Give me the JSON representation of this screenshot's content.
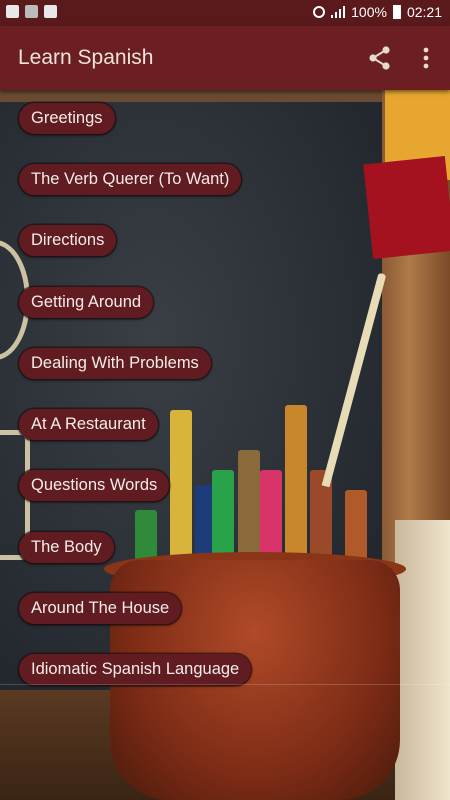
{
  "status_bar": {
    "left_icons": [
      "facebook-icon",
      "m-app-icon",
      "image-icon"
    ],
    "battery_text": "100%",
    "time": "02:21"
  },
  "app_bar": {
    "title": "Learn Spanish",
    "share_icon": "share-icon",
    "menu_icon": "more-vert-icon"
  },
  "topics": [
    {
      "label": "Greetings"
    },
    {
      "label": "The Verb Querer (To Want)"
    },
    {
      "label": "Directions"
    },
    {
      "label": "Getting Around"
    },
    {
      "label": "Dealing With Problems"
    },
    {
      "label": "At A Restaurant"
    },
    {
      "label": "Questions Words"
    },
    {
      "label": "The Body"
    },
    {
      "label": "Around The House"
    },
    {
      "label": "Idiomatic Spanish Language"
    }
  ],
  "colors": {
    "app_bar": "#6b1f22",
    "status_bar": "#5a1a1c",
    "button_bg": "#601c20",
    "button_text": "#f5ece8"
  }
}
